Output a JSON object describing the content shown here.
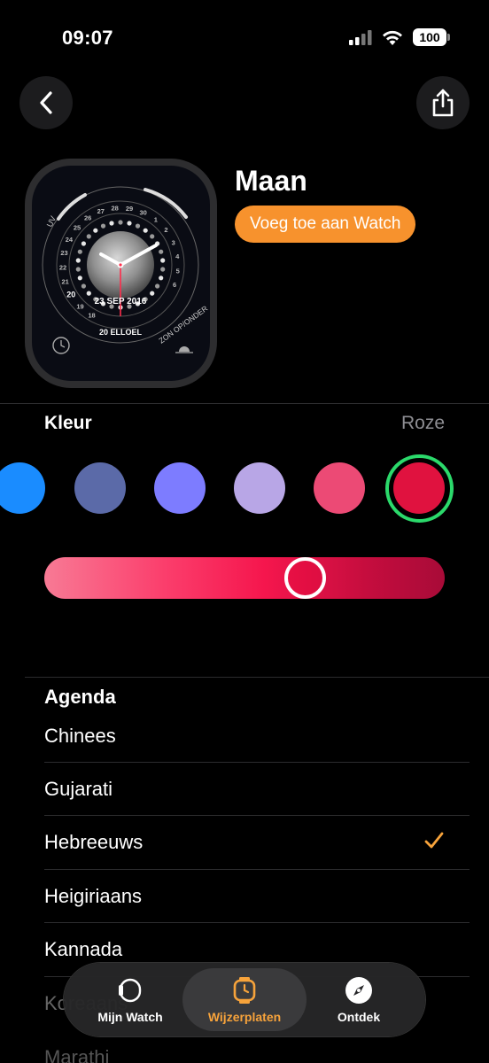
{
  "status_bar": {
    "time": "09:07",
    "battery": "100"
  },
  "face": {
    "title": "Maan",
    "add_button": "Voeg toe aan Watch",
    "preview": {
      "date": "23 SEP 2016",
      "hebrew_date": "20 ELLOEL",
      "complication_uv": "UV",
      "complication_sun": "ZON OP/ONDER",
      "ring_numbers": [
        "18",
        "19",
        "20",
        "21",
        "22",
        "23",
        "24",
        "25",
        "26",
        "27",
        "28",
        "29",
        "30",
        "1",
        "2",
        "3",
        "4",
        "5",
        "6"
      ]
    }
  },
  "color": {
    "label": "Kleur",
    "selected": "Roze",
    "swatches": [
      "#1a8cff",
      "#5b6aa8",
      "#7d7cff",
      "#b8a6e6",
      "#ec4a75",
      "#e0123f"
    ],
    "slider_position": 0.67
  },
  "calendar": {
    "title": "Agenda",
    "items": [
      {
        "label": "Chinees",
        "checked": false
      },
      {
        "label": "Gujarati",
        "checked": false
      },
      {
        "label": "Hebreeuws",
        "checked": true
      },
      {
        "label": "Heigiriaans",
        "checked": false
      },
      {
        "label": "Kannada",
        "checked": false
      },
      {
        "label": "Koreaans",
        "checked": false
      },
      {
        "label": "Marathi",
        "checked": false
      }
    ]
  },
  "tab_bar": {
    "tabs": [
      {
        "label": "Mijn Watch",
        "icon": "watch-outline-icon",
        "active": false
      },
      {
        "label": "Wijzerplaten",
        "icon": "watch-face-icon",
        "active": true
      },
      {
        "label": "Ontdek",
        "icon": "compass-icon",
        "active": false
      }
    ],
    "active_color": "#f7a33b"
  }
}
